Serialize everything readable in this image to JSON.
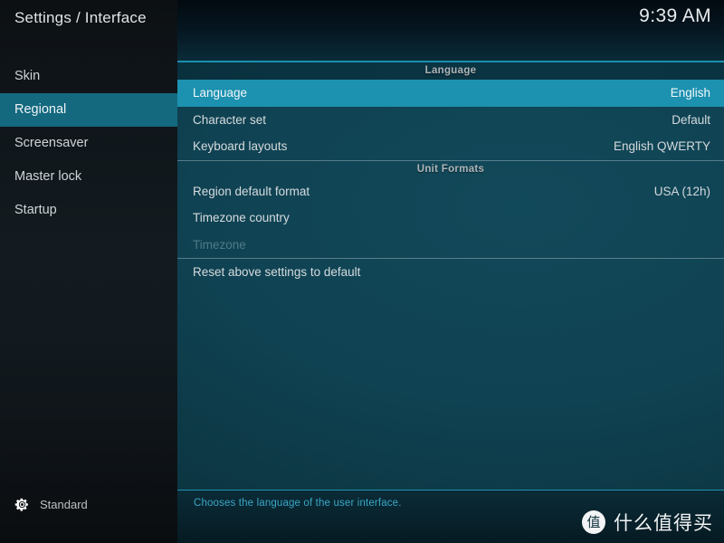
{
  "window": {
    "title": "Settings / Interface",
    "clock": "9:39 AM"
  },
  "colors": {
    "accent": "#1c91b0",
    "accent_line": "#1c8fae",
    "sidebar_selected": "#14697f",
    "panel_bg": "#0f4252",
    "sidebar_bg": "#0e1317",
    "help_text": "#3aa7c6"
  },
  "sidebar": {
    "items": [
      {
        "label": "Skin",
        "selected": false
      },
      {
        "label": "Regional",
        "selected": true
      },
      {
        "label": "Screensaver",
        "selected": false
      },
      {
        "label": "Master lock",
        "selected": false
      },
      {
        "label": "Startup",
        "selected": false
      }
    ],
    "footer": {
      "icon": "gear-icon",
      "label": "Standard"
    }
  },
  "main": {
    "sections": [
      {
        "header": "Language",
        "header_style": "band",
        "rows": [
          {
            "label": "Language",
            "value": "English",
            "selected": true,
            "disabled": false
          },
          {
            "label": "Character set",
            "value": "Default",
            "selected": false,
            "disabled": false
          },
          {
            "label": "Keyboard layouts",
            "value": "English QWERTY",
            "selected": false,
            "disabled": false
          }
        ]
      },
      {
        "header": "Unit Formats",
        "header_style": "plain",
        "rows": [
          {
            "label": "Region default format",
            "value": "USA (12h)",
            "selected": false,
            "disabled": false
          },
          {
            "label": "Timezone country",
            "value": "",
            "selected": false,
            "disabled": false
          },
          {
            "label": "Timezone",
            "value": "",
            "selected": false,
            "disabled": true
          }
        ]
      },
      {
        "header": "",
        "header_style": "none",
        "rows": [
          {
            "label": "Reset above settings to default",
            "value": "",
            "selected": false,
            "disabled": false
          }
        ]
      }
    ]
  },
  "help": {
    "text": "Chooses the language of the user interface."
  },
  "watermark": {
    "badge": "值",
    "text": "什么值得买"
  }
}
